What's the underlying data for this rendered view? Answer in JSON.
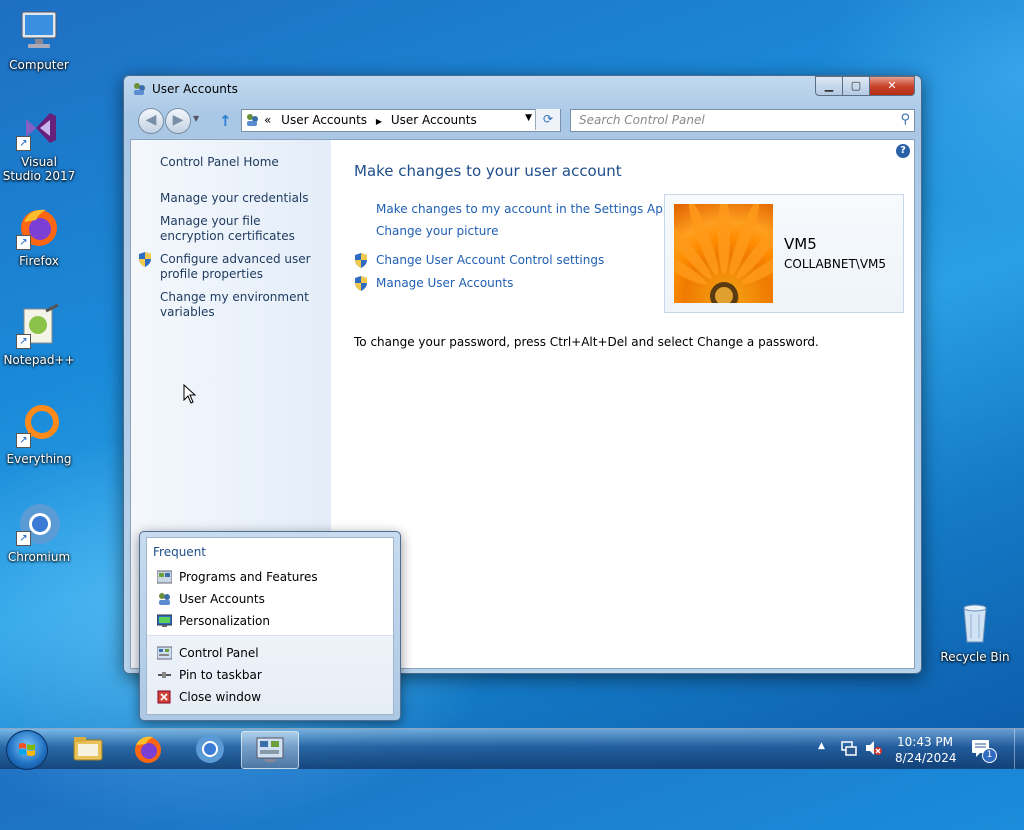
{
  "desktop": {
    "icons": [
      {
        "label": "Computer",
        "icon": "computer-icon"
      },
      {
        "label": "Visual Studio 2017",
        "icon": "visual-studio-icon"
      },
      {
        "label": "Firefox",
        "icon": "firefox-icon"
      },
      {
        "label": "Notepad++",
        "icon": "notepad-plus-plus-icon"
      },
      {
        "label": "Everything",
        "icon": "everything-icon"
      },
      {
        "label": "Chromium",
        "icon": "chromium-icon"
      },
      {
        "label": "Recycle Bin",
        "icon": "recycle-bin-icon"
      }
    ]
  },
  "window": {
    "title": "User Accounts",
    "address": {
      "root": "«",
      "crumb1": "User Accounts",
      "crumb2": "User Accounts"
    },
    "search_placeholder": "Search Control Panel",
    "left_pane": {
      "home": "Control Panel Home",
      "items": [
        "Manage your credentials",
        "Manage your file encryption certificates",
        "Configure advanced user profile properties",
        "Change my environment variables"
      ]
    },
    "main": {
      "heading": "Make changes to your user account",
      "links": [
        "Make changes to my account in the Settings App",
        "Change your picture",
        "Change User Account Control settings",
        "Manage User Accounts"
      ],
      "user_name": "VM5",
      "user_domain": "COLLABNET\\VM5",
      "password_text": "To change your password, press Ctrl+Alt+Del and select Change a password."
    }
  },
  "jumplist": {
    "header": "Frequent",
    "frequent": [
      "Programs and Features",
      "User Accounts",
      "Personalization"
    ],
    "tasks": [
      "Control Panel",
      "Pin to taskbar",
      "Close window"
    ]
  },
  "taskbar": {
    "time": "10:43 PM",
    "date": "8/24/2024",
    "notification_count": "1"
  },
  "colors": {
    "link": "#1f5fb4",
    "heading": "#1e4e8c",
    "close_button": "#c7452c"
  }
}
